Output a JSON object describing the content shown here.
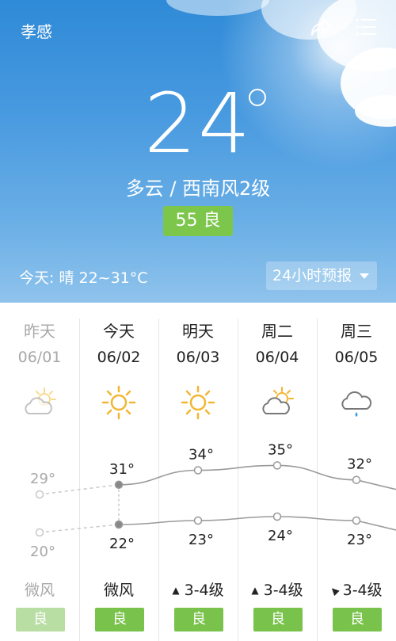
{
  "header": {
    "city": "孝感"
  },
  "current": {
    "temp": "24",
    "condition": "多云 / 西南风2级",
    "aqi": "55 良",
    "today": "今天:  晴  22~31°C",
    "forecast_btn": "24小时预报"
  },
  "days": [
    {
      "name": "昨天",
      "date": "06/01",
      "icon": "partly-cloudy-icon",
      "high": "29°",
      "low": "20°",
      "wind": "微风",
      "quality": "良",
      "past": true
    },
    {
      "name": "今天",
      "date": "06/02",
      "icon": "sunny-icon",
      "high": "31°",
      "low": "22°",
      "wind": "微风",
      "quality": "良"
    },
    {
      "name": "明天",
      "date": "06/03",
      "icon": "sunny-icon",
      "high": "34°",
      "low": "23°",
      "wind": "3-4级",
      "quality": "良"
    },
    {
      "name": "周二",
      "date": "06/04",
      "icon": "partly-cloudy-icon",
      "high": "35°",
      "low": "24°",
      "wind": "3-4级",
      "quality": "良"
    },
    {
      "name": "周三",
      "date": "06/05",
      "icon": "rain-icon",
      "high": "32°",
      "low": "23°",
      "wind": "3-4级",
      "quality": "良"
    }
  ],
  "chart_data": {
    "type": "line",
    "categories": [
      "06/01",
      "06/02",
      "06/03",
      "06/04",
      "06/05"
    ],
    "series": [
      {
        "values": [
          29,
          31,
          34,
          35,
          32
        ]
      },
      {
        "values": [
          20,
          22,
          23,
          24,
          23
        ]
      }
    ]
  },
  "colors": {
    "sky_top": "#2f8ad7",
    "badge_green": "#79c24b",
    "aqi_green": "#7cc64c",
    "line_gray": "#9a9a9a"
  }
}
